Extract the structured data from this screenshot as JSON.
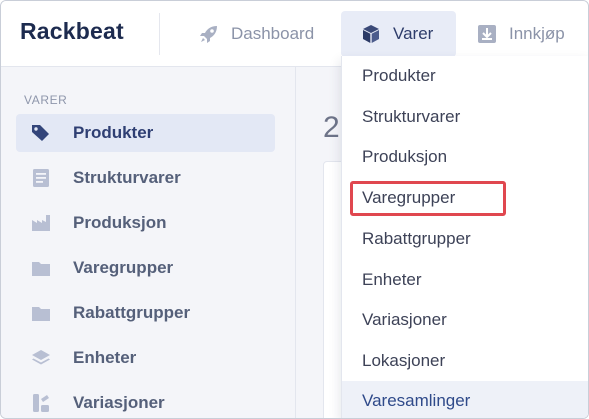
{
  "header": {
    "logo": "Rackbeat",
    "nav": [
      {
        "label": "Dashboard",
        "icon": "rocket-icon"
      },
      {
        "label": "Varer",
        "icon": "cube-icon"
      },
      {
        "label": "Innkjøp",
        "icon": "download-icon"
      }
    ]
  },
  "sidebar": {
    "heading": "VARER",
    "items": [
      {
        "label": "Produkter",
        "icon": "tag-icon"
      },
      {
        "label": "Strukturvarer",
        "icon": "document-icon"
      },
      {
        "label": "Produksjon",
        "icon": "factory-icon"
      },
      {
        "label": "Varegrupper",
        "icon": "folder-icon"
      },
      {
        "label": "Rabattgrupper",
        "icon": "folder-icon"
      },
      {
        "label": "Enheter",
        "icon": "layers-icon"
      },
      {
        "label": "Variasjoner",
        "icon": "variants-icon"
      }
    ]
  },
  "main": {
    "number": "2"
  },
  "dropdown": {
    "items": [
      {
        "label": "Produkter"
      },
      {
        "label": "Strukturvarer"
      },
      {
        "label": "Produksjon"
      },
      {
        "label": "Varegrupper"
      },
      {
        "label": "Rabattgrupper"
      },
      {
        "label": "Enheter"
      },
      {
        "label": "Variasjoner"
      },
      {
        "label": "Lokasjoner"
      },
      {
        "label": "Varesamlinger"
      }
    ]
  },
  "colors": {
    "brand": "#1d2b4f",
    "highlight": "#e0474f",
    "active_bg": "#e3e8f5"
  }
}
